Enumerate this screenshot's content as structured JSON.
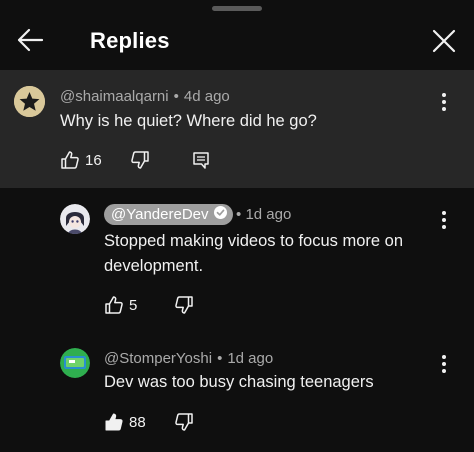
{
  "header": {
    "title": "Replies",
    "back_icon": "arrow-left-icon",
    "close_icon": "close-icon"
  },
  "parent_comment": {
    "author": "@shaimaalqarni",
    "time": "4d ago",
    "text": "Why is he quiet? Where did he go?",
    "likes": "16",
    "avatar_icon": "star-icon"
  },
  "replies": [
    {
      "author": "@YandereDev",
      "time": "1d ago",
      "text_line1": "Stopped making videos to focus more on",
      "text_line2": "development.",
      "likes": "5",
      "verified_icon": "verified-check-icon",
      "creator_highlight": true
    },
    {
      "author": "@StomperYoshi",
      "time": "1d ago",
      "text": "Dev was too busy chasing teenagers",
      "likes": "88",
      "liked": true
    }
  ],
  "colors": {
    "background": "#0f0f0f",
    "highlight": "#272727",
    "text": "#f1f1f1",
    "secondary": "#aaaaaa",
    "creator_chip": "#9e9e9e"
  }
}
